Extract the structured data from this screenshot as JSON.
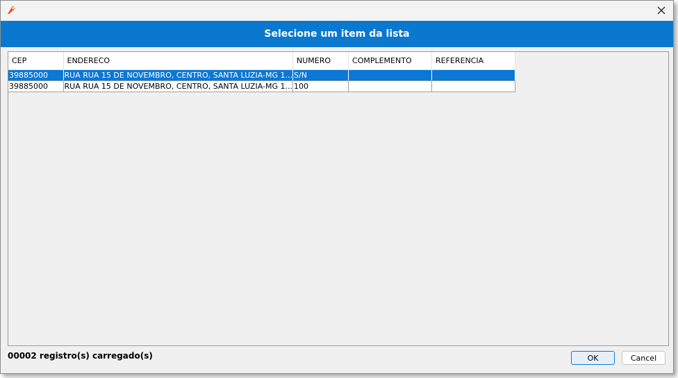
{
  "window": {
    "title": "",
    "header_title": "Selecione um item da lista"
  },
  "table": {
    "columns": [
      "CEP",
      "ENDERECO",
      "NUMERO",
      "COMPLEMENTO",
      "REFERENCIA"
    ],
    "rows": [
      {
        "cep": "39885000",
        "endereco": "RUA RUA 15 DE NOVEMBRO, CENTRO, SANTA LUZIA-MG 1...",
        "numero": "S/N",
        "complemento": "",
        "referencia": "",
        "selected": true
      },
      {
        "cep": "39885000",
        "endereco": "RUA RUA 15 DE NOVEMBRO, CENTRO, SANTA LUZIA-MG 1...",
        "numero": "100",
        "complemento": "",
        "referencia": "",
        "selected": false
      }
    ]
  },
  "status": {
    "text": "00002 registro(s) carregado(s)"
  },
  "buttons": {
    "ok": "OK",
    "cancel": "Cancel"
  },
  "colors": {
    "accent": "#0a78cf",
    "selection": "#0a78d7"
  }
}
